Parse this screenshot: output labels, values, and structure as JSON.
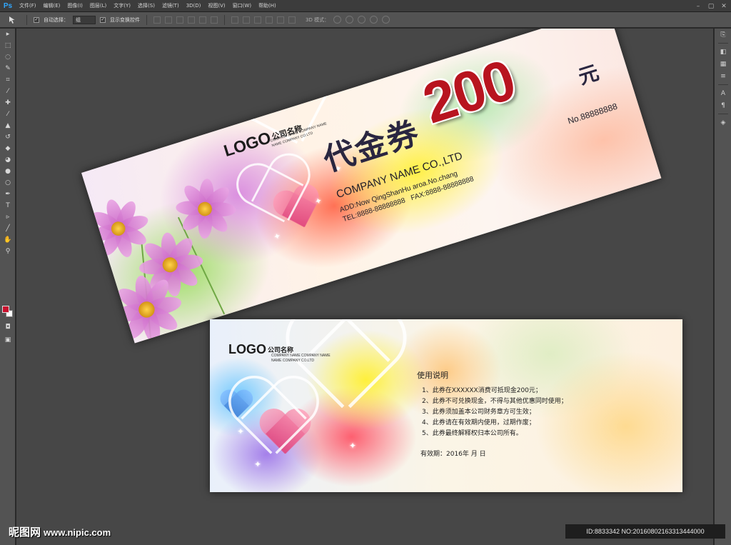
{
  "app": {
    "logo": "Ps",
    "menu": [
      "文件(F)",
      "编辑(E)",
      "图像(I)",
      "图层(L)",
      "文字(Y)",
      "选择(S)",
      "滤镜(T)",
      "3D(D)",
      "视图(V)",
      "窗口(W)",
      "帮助(H)"
    ],
    "window_controls": [
      "–",
      "▢",
      "✕"
    ]
  },
  "options_bar": {
    "tool_icon": "move-tool-icon",
    "auto_select_label": "自动选择：",
    "auto_select_value": "组",
    "transform_label": "显示变换控件",
    "mode_3d_label": "3D 模式："
  },
  "toolbar": {
    "tools": [
      "move-tool-icon",
      "marquee-tool-icon",
      "lasso-tool-icon",
      "quick-select-icon",
      "crop-tool-icon",
      "eyedropper-icon",
      "healing-brush-icon",
      "brush-tool-icon",
      "clone-stamp-icon",
      "history-brush-icon",
      "eraser-icon",
      "paint-bucket-icon",
      "blur-tool-icon",
      "dodge-tool-icon",
      "pen-tool-icon",
      "type-tool-icon",
      "path-select-icon",
      "line-tool-icon",
      "hand-tool-icon",
      "zoom-tool-icon"
    ],
    "foreground_color": "#c8102e",
    "background_color": "#ffffff"
  },
  "coupon_front": {
    "logo": "LOGO",
    "company_zh": "公司名称",
    "company_sub_1": "COMPANY NAME COMPANY NAME",
    "company_sub_2": "NAME COMPANY CO.LTD",
    "title": "代金券",
    "amount": "200",
    "unit": "元",
    "number": "No.88888888",
    "company_en": "COMPANY NAME CO.,LTD",
    "address": "ADD:Now QingShanHu aroa.No.chang",
    "tel": "TEL:8888-88888888",
    "fax": "FAX:8888-88888888"
  },
  "coupon_back": {
    "logo": "LOGO",
    "company_zh": "公司名称",
    "company_sub_1": "COMPANY NAME COMPANY NAME",
    "company_sub_2": "NAME COMPANY CO.LTD",
    "rules_title": "使用说明",
    "rules": [
      "1、此券在XXXXXX消费可抵现金200元；",
      "2、此券不可兑换现金，不得与其他优惠同时使用；",
      "3、此券须加盖本公司财务章方可生效；",
      "4、此券请在有效期内使用，过期作废；",
      "5、此券最终解释权归本公司所有。"
    ],
    "validity": "有效期：2016年   月   日"
  },
  "watermark": {
    "site": "昵图网",
    "url": "www.nipic.com",
    "id": "ID:8833342 NO:20160802163313444000"
  }
}
